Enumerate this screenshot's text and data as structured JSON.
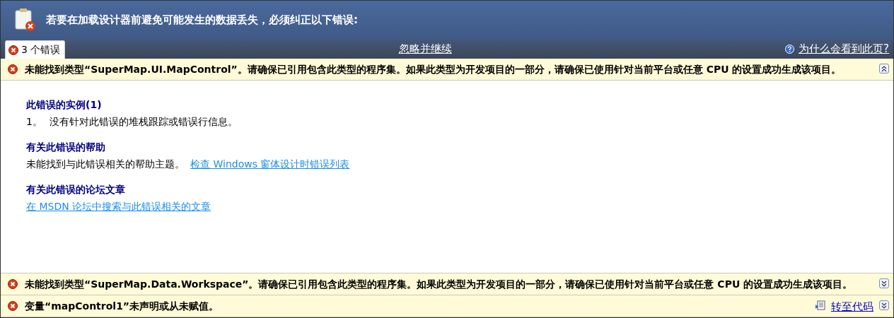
{
  "header": {
    "title": "若要在加载设计器前避免可能发生的数据丢失，必须纠正以下错误:"
  },
  "tab": {
    "label": "3 个错误",
    "selected": true
  },
  "ignore_link": "忽略并继续",
  "why_link": "为什么会看到此页?",
  "errors": [
    {
      "message": "未能找到类型“SuperMap.UI.MapControl”。请确保已引用包含此类型的程序集。如果此类型为开发项目的一部分，请确保已使用针对当前平台或任意 CPU 的设置成功生成该项目。",
      "expanded": true,
      "details": [
        {
          "kind": "list",
          "title": "此错误的实例(1)",
          "items": [
            {
              "number": "1。",
              "text": "没有针对此错误的堆栈跟踪或错误行信息。"
            }
          ]
        },
        {
          "kind": "text_link",
          "title": "有关此错误的帮助",
          "text": "未能找到与此错误相关的帮助主题。",
          "link": "检查 Windows 窗体设计时错误列表"
        },
        {
          "kind": "link",
          "title": "有关此错误的论坛文章",
          "link": "在 MSDN 论坛中搜索与此错误相关的文章"
        }
      ]
    },
    {
      "message": "未能找到类型“SuperMap.Data.Workspace”。请确保已引用包含此类型的程序集。如果此类型为开发项目的一部分，请确保已使用针对当前平台或任意 CPU 的设置成功生成该项目。",
      "expanded": false
    },
    {
      "message": "变量“mapControl1”未声明或从未赋值。",
      "expanded": false,
      "goto_code": "转至代码"
    }
  ]
}
